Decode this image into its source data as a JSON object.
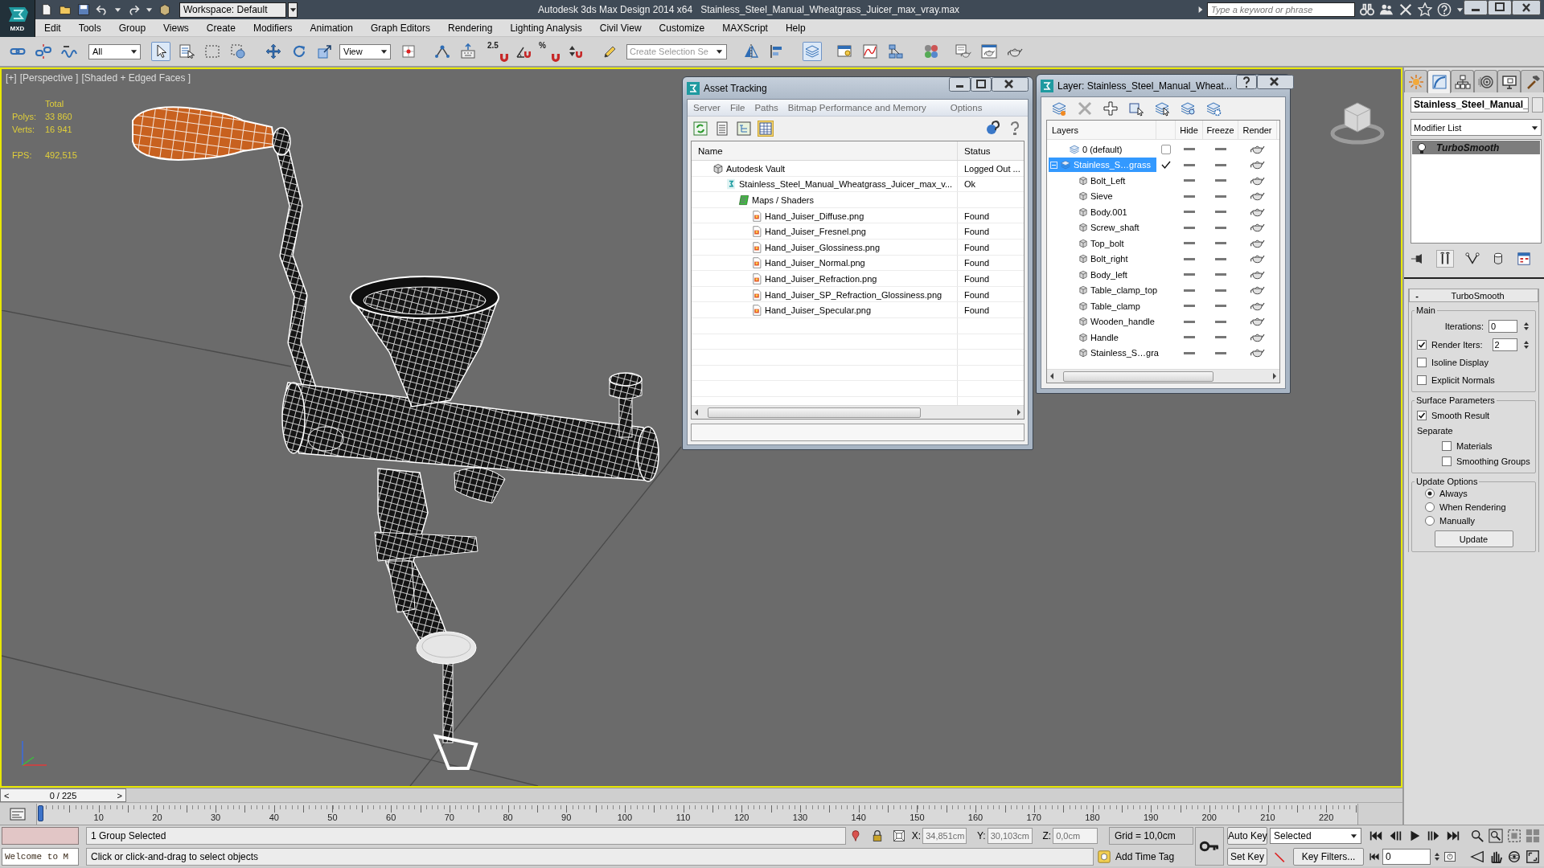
{
  "title_bar": {
    "logo": "MXD",
    "workspace": "Workspace: Default",
    "app_title": "Autodesk 3ds Max Design 2014 x64",
    "file_name": "Stainless_Steel_Manual_Wheatgrass_Juicer_max_vray.max",
    "search": {
      "placeholder": "Type a keyword or phrase"
    }
  },
  "menu": [
    "Edit",
    "Tools",
    "Group",
    "Views",
    "Create",
    "Modifiers",
    "Animation",
    "Graph Editors",
    "Rendering",
    "Lighting Analysis",
    "Civil View",
    "Customize",
    "MAXScript",
    "Help"
  ],
  "toolbar": [
    {
      "kind": "link",
      "selected": false
    },
    {
      "kind": "unlink",
      "selected": false
    },
    {
      "kind": "bind",
      "selected": false
    },
    {
      "kind": "selection_filter",
      "value": "All"
    },
    {
      "kind": "select",
      "selected": true
    },
    {
      "kind": "select_by_name",
      "selected": false
    },
    {
      "kind": "region",
      "selected": false
    },
    {
      "kind": "crossing",
      "selected": false
    },
    {
      "kind": "move",
      "selected": false
    },
    {
      "kind": "rotate",
      "selected": false
    },
    {
      "kind": "scale",
      "selected": false
    },
    {
      "kind": "reference_coord",
      "value": "View"
    },
    {
      "kind": "pivot",
      "selected": false
    },
    {
      "kind": "manipulate",
      "selected": false
    },
    {
      "kind": "shortcut",
      "selected": false
    },
    {
      "kind": "snap",
      "label": "2.5",
      "selected": false
    },
    {
      "kind": "angle_snap",
      "selected": false
    },
    {
      "kind": "percent_snap",
      "label": "%",
      "selected": false
    },
    {
      "kind": "spinner_snap",
      "selected": false
    },
    {
      "kind": "named_sets",
      "selected": false
    },
    {
      "kind": "combo",
      "placeholder": "Create Selection Se"
    },
    {
      "kind": "mirror",
      "selected": false
    },
    {
      "kind": "align",
      "selected": false
    },
    {
      "kind": "layers",
      "selected": true
    },
    {
      "kind": "ribbon",
      "selected": false
    },
    {
      "kind": "curve_editor",
      "selected": false
    },
    {
      "kind": "schematic",
      "selected": false
    },
    {
      "kind": "material_editor",
      "selected": false
    },
    {
      "kind": "render_setup",
      "selected": false
    },
    {
      "kind": "frame_window",
      "selected": false
    },
    {
      "kind": "render",
      "selected": false
    }
  ],
  "viewport": {
    "active": true,
    "labels": [
      "[+]",
      "[Perspective ]",
      "[Shaded + Edged Faces ]"
    ],
    "stats": {
      "header": "Total",
      "rows": [
        {
          "label": "Polys:",
          "value": "33 860"
        },
        {
          "label": "Verts:",
          "value": "16 941"
        }
      ],
      "fps": {
        "label": "FPS:",
        "value": "492,515"
      }
    }
  },
  "asset_tracking": {
    "title": "Asset Tracking",
    "menu": [
      "Server",
      "File",
      "Paths",
      "Bitmap Performance and Memory",
      "Options"
    ],
    "view_buttons": [
      {
        "kind": "refresh",
        "selected": false
      },
      {
        "kind": "list",
        "selected": false
      },
      {
        "kind": "thumbnail",
        "selected": false
      },
      {
        "kind": "table",
        "selected": true
      }
    ],
    "columns": [
      "Name",
      "Status"
    ],
    "tree": [
      {
        "kind": "vault",
        "name": "Autodesk Vault",
        "status": "Logged Out ...",
        "selected": false,
        "children": [
          {
            "kind": "scene",
            "name": "Stainless_Steel_Manual_Wheatgrass_Juicer_max_v...",
            "status": "Ok",
            "selected": false,
            "children": [
              {
                "kind": "folder",
                "name": "Maps / Shaders",
                "selected": false,
                "children": [
                  {
                    "kind": "bitmap",
                    "name": "Hand_Juiser_Diffuse.png",
                    "status": "Found",
                    "selected": false
                  },
                  {
                    "kind": "bitmap",
                    "name": "Hand_Juiser_Fresnel.png",
                    "status": "Found",
                    "selected": false
                  },
                  {
                    "kind": "bitmap",
                    "name": "Hand_Juiser_Glossiness.png",
                    "status": "Found",
                    "selected": false
                  },
                  {
                    "kind": "bitmap",
                    "name": "Hand_Juiser_Normal.png",
                    "status": "Found",
                    "selected": false
                  },
                  {
                    "kind": "bitmap",
                    "name": "Hand_Juiser_Refraction.png",
                    "status": "Found",
                    "selected": false
                  },
                  {
                    "kind": "bitmap",
                    "name": "Hand_Juiser_SP_Refraction_Glossiness.png",
                    "status": "Found",
                    "selected": false
                  },
                  {
                    "kind": "bitmap",
                    "name": "Hand_Juiser_Specular.png",
                    "status": "Found",
                    "selected": false
                  }
                ]
              }
            ]
          }
        ]
      }
    ]
  },
  "layer_manager": {
    "title": "Layer: Stainless_Steel_Manual_Wheat...",
    "columns": [
      "Layers",
      "Hide",
      "Freeze",
      "Render"
    ],
    "layers": [
      {
        "name": "0 (default)",
        "selected": false,
        "current": false,
        "hidden": false,
        "frozen": false,
        "renderable": true
      },
      {
        "name": "Stainless_S…grass",
        "selected": true,
        "current": true,
        "expanded": true,
        "hidden": false,
        "frozen": false,
        "renderable": true,
        "children": [
          {
            "name": "Bolt_Left",
            "selected": false,
            "hidden": false,
            "frozen": false,
            "renderable": true
          },
          {
            "name": "Sieve",
            "selected": false,
            "hidden": false,
            "frozen": false,
            "renderable": true
          },
          {
            "name": "Body.001",
            "selected": false,
            "hidden": false,
            "frozen": false,
            "renderable": true
          },
          {
            "name": "Screw_shaft",
            "selected": false,
            "hidden": false,
            "frozen": false,
            "renderable": true
          },
          {
            "name": "Top_bolt",
            "selected": false,
            "hidden": false,
            "frozen": false,
            "renderable": true
          },
          {
            "name": "Bolt_right",
            "selected": false,
            "hidden": false,
            "frozen": false,
            "renderable": true
          },
          {
            "name": "Body_left",
            "selected": false,
            "hidden": false,
            "frozen": false,
            "renderable": true
          },
          {
            "name": "Table_clamp_top",
            "selected": false,
            "hidden": false,
            "frozen": false,
            "renderable": true
          },
          {
            "name": "Table_clamp",
            "selected": false,
            "hidden": false,
            "frozen": false,
            "renderable": true
          },
          {
            "name": "Wooden_handle",
            "selected": false,
            "hidden": false,
            "frozen": false,
            "renderable": true
          },
          {
            "name": "Handle",
            "selected": false,
            "hidden": false,
            "frozen": false,
            "renderable": true
          },
          {
            "name": "Stainless_S…gra",
            "selected": false,
            "hidden": false,
            "frozen": false,
            "renderable": true
          }
        ]
      }
    ]
  },
  "command_panel": {
    "tabs": [
      {
        "kind": "create",
        "selected": false
      },
      {
        "kind": "modify",
        "selected": true
      },
      {
        "kind": "hierarchy",
        "selected": false
      },
      {
        "kind": "motion",
        "selected": false
      },
      {
        "kind": "display",
        "selected": false
      },
      {
        "kind": "utilities",
        "selected": false
      }
    ],
    "object_name": "Stainless_Steel_Manual_",
    "modifier_list": "Modifier List",
    "stack": [
      {
        "name": "TurboSmooth",
        "selected": true,
        "on": true
      }
    ],
    "rollout": {
      "toggle": "-",
      "title": "TurboSmooth",
      "groups": [
        {
          "title": "Main",
          "items": [
            {
              "kind": "spinner",
              "label": "Iterations:",
              "value": "0"
            },
            {
              "kind": "check_spinner",
              "label": "Render Iters:",
              "value": "2",
              "checked": true
            },
            {
              "kind": "checkbox",
              "label": "Isoline Display",
              "checked": false
            },
            {
              "kind": "checkbox",
              "label": "Explicit Normals",
              "checked": false
            }
          ]
        },
        {
          "title": "Surface Parameters",
          "items": [
            {
              "kind": "checkbox",
              "label": "Smooth Result",
              "checked": true
            },
            {
              "kind": "label",
              "label": "Separate"
            },
            {
              "kind": "sub_checkbox",
              "label": "Materials",
              "checked": false
            },
            {
              "kind": "sub_checkbox",
              "label": "Smoothing Groups",
              "checked": false
            }
          ]
        },
        {
          "title": "Update Options",
          "items": [
            {
              "kind": "radio",
              "label": "Always",
              "selected": true
            },
            {
              "kind": "radio",
              "label": "When Rendering",
              "selected": false
            },
            {
              "kind": "radio",
              "label": "Manually",
              "selected": false
            },
            {
              "kind": "button",
              "label": "Update"
            }
          ]
        }
      ]
    }
  },
  "time_slider": {
    "prev": "<",
    "position": "0 / 225",
    "next": ">",
    "level": 0
  },
  "track_bar": {
    "labels": [
      "10",
      "20",
      "30",
      "40",
      "50",
      "60",
      "70",
      "80",
      "90",
      "100",
      "110",
      "120",
      "130",
      "140",
      "150",
      "160",
      "170",
      "180",
      "190",
      "200",
      "210",
      "220"
    ]
  },
  "status_bar": {
    "listener_output": "Welcome to M",
    "selection": "1 Group Selected",
    "prompt": "Click or click-and-drag to select objects",
    "coords": [
      {
        "axis": "X:",
        "value": "34,851cm",
        "disabled": true
      },
      {
        "axis": "Y:",
        "value": "30,103cm",
        "disabled": true
      },
      {
        "axis": "Z:",
        "value": "0,0cm",
        "disabled": true
      }
    ],
    "grid": "Grid = 10,0cm",
    "time_tag": "Add Time Tag",
    "auto_key": "Auto Key",
    "key_set": "Selected",
    "set_key": "Set Key",
    "key_filters": "Key Filters...",
    "frame": "0"
  }
}
